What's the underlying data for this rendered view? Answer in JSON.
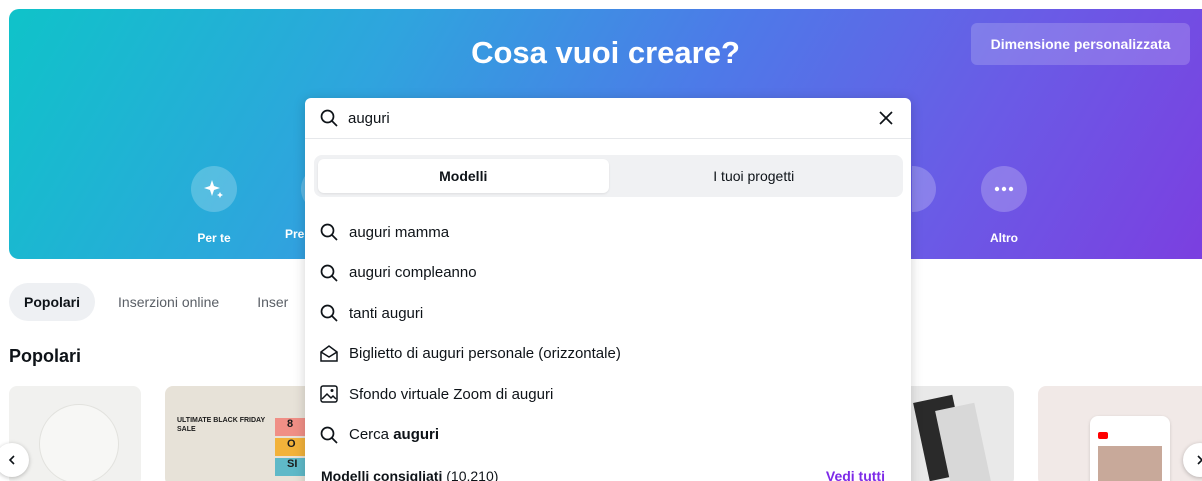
{
  "hero": {
    "title": "Cosa vuoi creare?",
    "custom_size_button": "Dimensione personalizzata",
    "categories": [
      {
        "label": "Per te",
        "icon": "sparkle-icon"
      },
      {
        "label": "Pre",
        "icon": "partial-icon"
      },
      {
        "label": "Altro",
        "icon": "more-dots-icon"
      }
    ]
  },
  "filters": {
    "chips": [
      "Popolari",
      "Inserzioni online",
      "Inser"
    ]
  },
  "section": {
    "title": "Popolari"
  },
  "search": {
    "value": "auguri",
    "tabs": [
      "Modelli",
      "I tuoi progetti"
    ],
    "suggestions": [
      {
        "icon": "search-icon",
        "text": "auguri mamma"
      },
      {
        "icon": "search-icon",
        "text": "auguri compleanno"
      },
      {
        "icon": "search-icon",
        "text": "tanti auguri"
      },
      {
        "icon": "card-envelope-icon",
        "text": "Biglietto di auguri personale (orizzontale)"
      },
      {
        "icon": "image-icon",
        "text": "Sfondo virtuale Zoom di auguri"
      },
      {
        "icon": "search-icon",
        "prefix": "Cerca ",
        "bold": "auguri"
      }
    ],
    "recommended": {
      "title": "Modelli consigliati",
      "count": "(10.210)",
      "see_all": "Vedi tutti"
    }
  },
  "cards": {
    "poster": {
      "top_text": "ULTIMATE BLACK FRIDAY SALE",
      "badges": [
        "8",
        "O",
        "SI"
      ]
    }
  },
  "colors": {
    "accent": "#7d2ae8",
    "hero_start": "#0fc3c9",
    "hero_end": "#7b3fe0"
  }
}
